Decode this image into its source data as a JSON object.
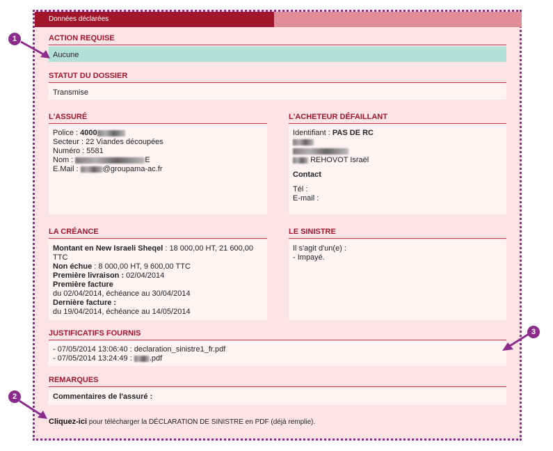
{
  "tab": {
    "label": "Données déclarées"
  },
  "action": {
    "title": "ACTION REQUISE",
    "value": "Aucune"
  },
  "statut": {
    "title": "STATUT DU DOSSIER",
    "value": "Transmise"
  },
  "assure": {
    "title": "L'ASSURÉ",
    "police_label": "Police : ",
    "police_value": "4000",
    "secteur": "Secteur : 22 Viandes découpées",
    "numero": "Numéro : 5581",
    "nom_label": "Nom : ",
    "nom_tail": "E",
    "email_label": "E.Mail : ",
    "email_tail": "@groupama-ac.fr"
  },
  "acheteur": {
    "title": "L'ACHETEUR DÉFAILLANT",
    "identifiant_label": "Identifiant : ",
    "identifiant_value": "PAS DE RC",
    "city": "REHOVOT Israël",
    "contact": "Contact",
    "tel": "Tél :",
    "email": "E-mail :"
  },
  "creance": {
    "title": "LA CRÉANCE",
    "montant_label": "Montant en New Israeli Sheqel",
    "montant_value": " : 18 000,00 HT, 21 600,00",
    "montant_value2": "TTC",
    "non_echue_label": "Non échue",
    "non_echue_value": " : 8 000,00 HT, 9 600,00 TTC",
    "premiere_livraison_label": "Première livraison :",
    "premiere_livraison_value": " 02/04/2014",
    "premiere_facture_label": "Première facture",
    "premiere_facture_value": "du 02/04/2014, échéance au 30/04/2014",
    "derniere_facture_label": "Dernière facture :",
    "derniere_facture_value": "du 19/04/2014, échéance au 14/05/2014"
  },
  "sinistre": {
    "title": "LE SINISTRE",
    "line1": "Il s'agit d'un(e) :",
    "line2": "- Impayé."
  },
  "justificatifs": {
    "title": "JUSTIFICATIFS FOURNIS",
    "file1": "- 07/05/2014 13:06:40 : declaration_sinistre1_fr.pdf",
    "file2_prefix": "- 07/05/2014 13:24:49 : ",
    "file2_suffix": ".pdf"
  },
  "remarques": {
    "title": "REMARQUES",
    "commentaires": "Commentaires de l'assuré :"
  },
  "footer": {
    "link": "Cliquez-ici",
    "text": " pour télécharger la DÉCLARATION DE SINISTRE en PDF (déjà remplie)."
  },
  "markers": [
    "1",
    "2",
    "3"
  ],
  "colors": {
    "accent": "#a1162b",
    "marker": "#8b2c8c",
    "green": "#b2e0d6",
    "panel": "#fbe3e6"
  }
}
